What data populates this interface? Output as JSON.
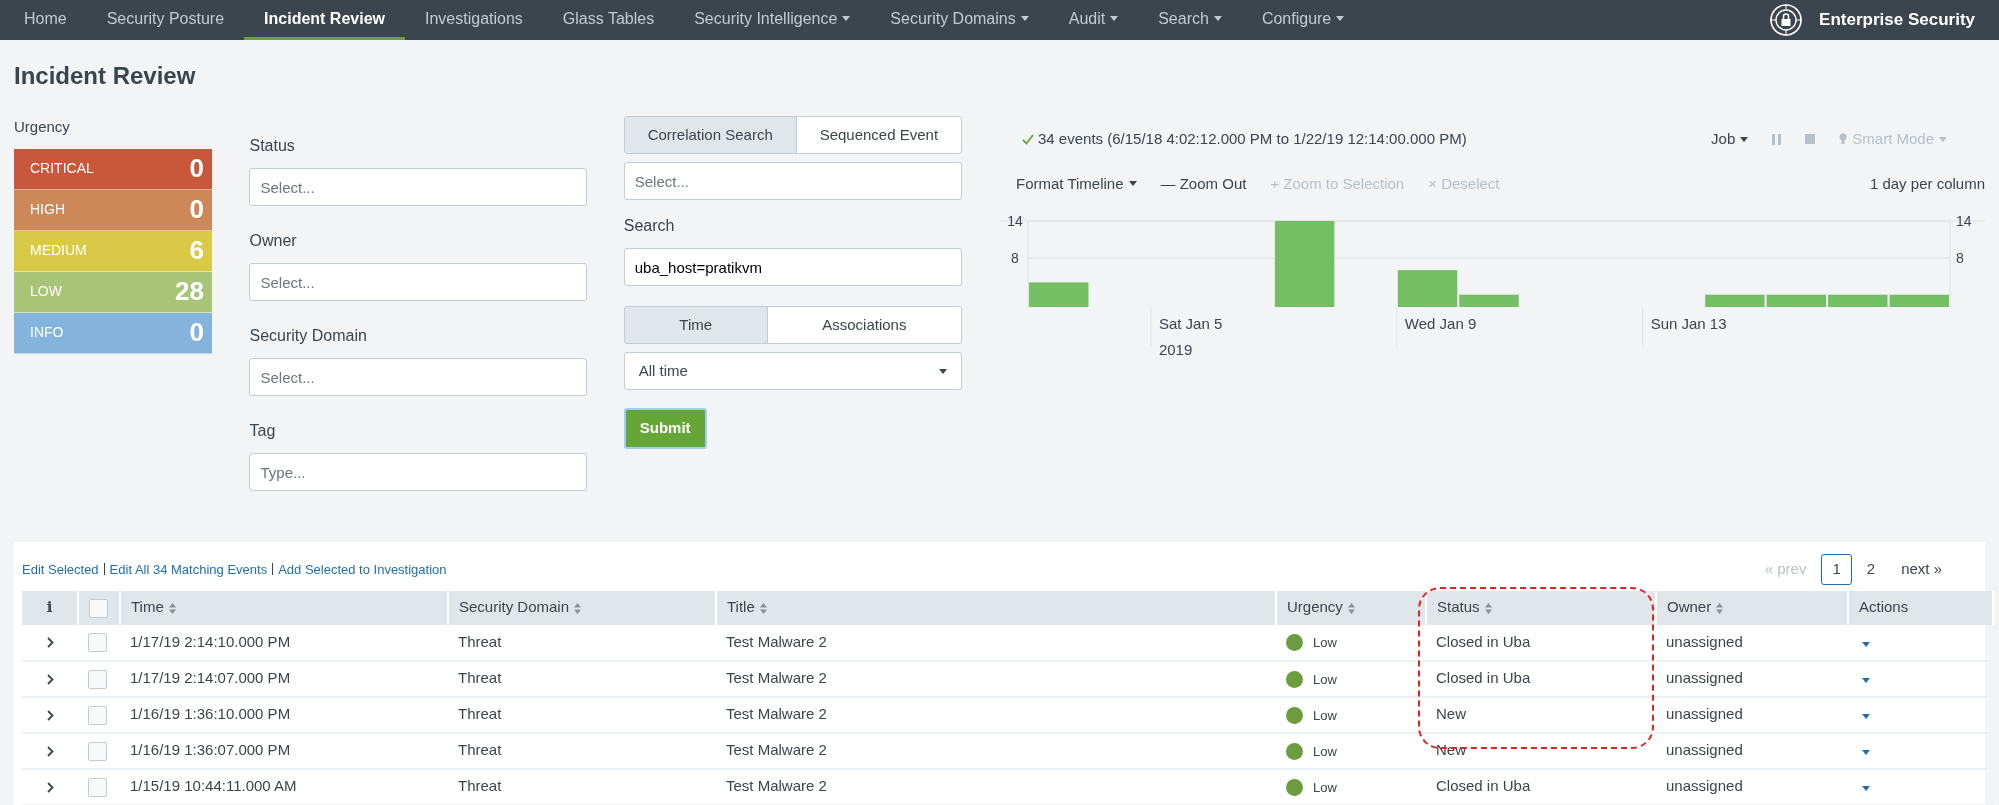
{
  "nav": {
    "items": [
      {
        "label": "Home",
        "selected": false,
        "dropdown": false
      },
      {
        "label": "Security Posture",
        "selected": false,
        "dropdown": false
      },
      {
        "label": "Incident Review",
        "selected": true,
        "dropdown": false
      },
      {
        "label": "Investigations",
        "selected": false,
        "dropdown": false
      },
      {
        "label": "Glass Tables",
        "selected": false,
        "dropdown": false
      },
      {
        "label": "Security Intelligence",
        "selected": false,
        "dropdown": true
      },
      {
        "label": "Security Domains",
        "selected": false,
        "dropdown": true
      },
      {
        "label": "Audit",
        "selected": false,
        "dropdown": true
      },
      {
        "label": "Search",
        "selected": false,
        "dropdown": true
      },
      {
        "label": "Configure",
        "selected": false,
        "dropdown": true
      }
    ],
    "brand": "Enterprise Security"
  },
  "page_title": "Incident Review",
  "urgency": {
    "label": "Urgency",
    "items": [
      {
        "label": "CRITICAL",
        "count": "0",
        "color": "#c8573c"
      },
      {
        "label": "HIGH",
        "count": "0",
        "color": "#cc8858"
      },
      {
        "label": "MEDIUM",
        "count": "6",
        "color": "#d8ca47"
      },
      {
        "label": "LOW",
        "count": "28",
        "color": "#a9c477"
      },
      {
        "label": "INFO",
        "count": "0",
        "color": "#84b3dc"
      }
    ]
  },
  "filters": [
    {
      "label": "Status",
      "placeholder": "Select..."
    },
    {
      "label": "Owner",
      "placeholder": "Select..."
    },
    {
      "label": "Security Domain",
      "placeholder": "Select..."
    },
    {
      "label": "Tag",
      "placeholder": "Type..."
    }
  ],
  "source_tabs": [
    {
      "label": "Correlation Search",
      "selected": true
    },
    {
      "label": "Sequenced Event",
      "selected": false
    }
  ],
  "source_select": {
    "placeholder": "Select..."
  },
  "search": {
    "label": "Search",
    "value": "uba_host=pratikvm"
  },
  "time_tabs": [
    {
      "label": "Time",
      "selected": true
    },
    {
      "label": "Associations",
      "selected": false
    }
  ],
  "time_select": {
    "value": "All time"
  },
  "submit": "Submit",
  "timeline": {
    "summary": "34 events (6/15/18 4:02:12.000 PM to 1/22/19 12:14:00.000 PM)",
    "job_menu": "Job",
    "mode_menu": {
      "label": "Smart Mode",
      "disabled": true
    },
    "toolbar": [
      {
        "label": "Format Timeline",
        "kind": "menu",
        "disabled": false
      },
      {
        "label": "— Zoom Out",
        "kind": "action",
        "disabled": false
      },
      {
        "label": "+ Zoom to Selection",
        "kind": "action",
        "disabled": true
      },
      {
        "label": "× Deselect",
        "kind": "action",
        "disabled": true
      }
    ],
    "scale_label": "1 day per column",
    "year_label": "2019",
    "chart_data": {
      "type": "bar",
      "categories": [
        null,
        null,
        "Sat Jan 5",
        null,
        null,
        null,
        "Wed Jan 9",
        null,
        null,
        null,
        "Sun Jan 13",
        null,
        null,
        null,
        null
      ],
      "series": [
        {
          "color": "#74be63",
          "values": [
            4,
            0,
            0,
            0,
            14,
            0,
            6,
            2,
            0,
            0,
            0,
            2,
            2,
            2,
            2
          ]
        }
      ],
      "ylim": [
        0,
        14
      ],
      "yticks": [
        {
          "value": 8,
          "label": "8"
        },
        {
          "value": 14,
          "label": "14"
        }
      ]
    },
    "right_axis_labels": [
      "14",
      "8"
    ]
  },
  "table": {
    "bulk_actions": [
      "Edit Selected",
      "Edit All 34 Matching Events",
      "Add Selected to Investigation"
    ],
    "pagination": [
      {
        "label": "« prev",
        "selected": false,
        "disabled": true
      },
      {
        "label": "1",
        "selected": true,
        "disabled": false
      },
      {
        "label": "2",
        "selected": false,
        "disabled": false
      },
      {
        "label": "next »",
        "selected": false,
        "disabled": false
      }
    ],
    "columns": [
      {
        "kind": "info",
        "label": "i"
      },
      {
        "kind": "checkbox",
        "checked": false
      },
      {
        "kind": "text",
        "label": "Time",
        "sortable": true
      },
      {
        "kind": "text",
        "label": "Security Domain",
        "sortable": true
      },
      {
        "kind": "text",
        "label": "Title",
        "sortable": true
      },
      {
        "kind": "text",
        "label": "Urgency",
        "sortable": true
      },
      {
        "kind": "text",
        "label": "Status",
        "sortable": true
      },
      {
        "kind": "text",
        "label": "Owner",
        "sortable": true
      },
      {
        "kind": "text",
        "label": "Actions",
        "sortable": false
      }
    ],
    "rows": [
      {
        "checked": false,
        "time": "1/17/19 2:14:10.000 PM",
        "security_domain": "Threat",
        "title": "Test Malware 2",
        "urgency": {
          "label": "Low",
          "color": "#6b9c3f"
        },
        "status": "Closed in Uba",
        "owner": "unassigned"
      },
      {
        "checked": false,
        "time": "1/17/19 2:14:07.000 PM",
        "security_domain": "Threat",
        "title": "Test Malware 2",
        "urgency": {
          "label": "Low",
          "color": "#6b9c3f"
        },
        "status": "Closed in Uba",
        "owner": "unassigned"
      },
      {
        "checked": false,
        "time": "1/16/19 1:36:10.000 PM",
        "security_domain": "Threat",
        "title": "Test Malware 2",
        "urgency": {
          "label": "Low",
          "color": "#6b9c3f"
        },
        "status": "New",
        "owner": "unassigned"
      },
      {
        "checked": false,
        "time": "1/16/19 1:36:07.000 PM",
        "security_domain": "Threat",
        "title": "Test Malware 2",
        "urgency": {
          "label": "Low",
          "color": "#6b9c3f"
        },
        "status": "New",
        "owner": "unassigned"
      },
      {
        "checked": false,
        "time": "1/15/19 10:44:11.000 AM",
        "security_domain": "Threat",
        "title": "Test Malware 2",
        "urgency": {
          "label": "Low",
          "color": "#6b9c3f"
        },
        "status": "Closed in Uba",
        "owner": "unassigned"
      }
    ]
  }
}
